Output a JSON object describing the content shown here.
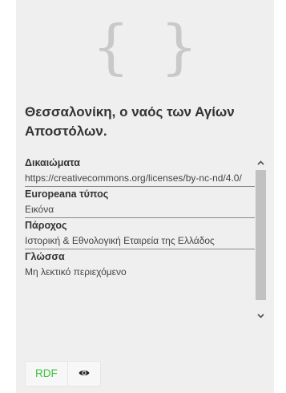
{
  "card": {
    "title": "Θεσσαλονίκη, ο ναός των Αγίων Αποστόλων.",
    "thumbnail_icon": "curly-braces-placeholder"
  },
  "metadata": [
    {
      "label": "Δικαιώματα",
      "value": "https://creativecommons.org/licenses/by-nc-nd/4.0/"
    },
    {
      "label": "Europeana τύπος",
      "value": "Εικόνα"
    },
    {
      "label": "Πάροχος",
      "value": "Ιστορική & Εθνολογική Εταιρεία της Ελλάδος"
    },
    {
      "label": "Γλώσσα",
      "value": "Μη λεκτικό περιεχόμενο"
    }
  ],
  "actions": {
    "rdf_label": "RDF",
    "view_icon": "eye-icon"
  },
  "colors": {
    "card_bg": "#efefef",
    "rdf_text": "#3fbf3f",
    "placeholder_icon": "#c9c9c9"
  }
}
